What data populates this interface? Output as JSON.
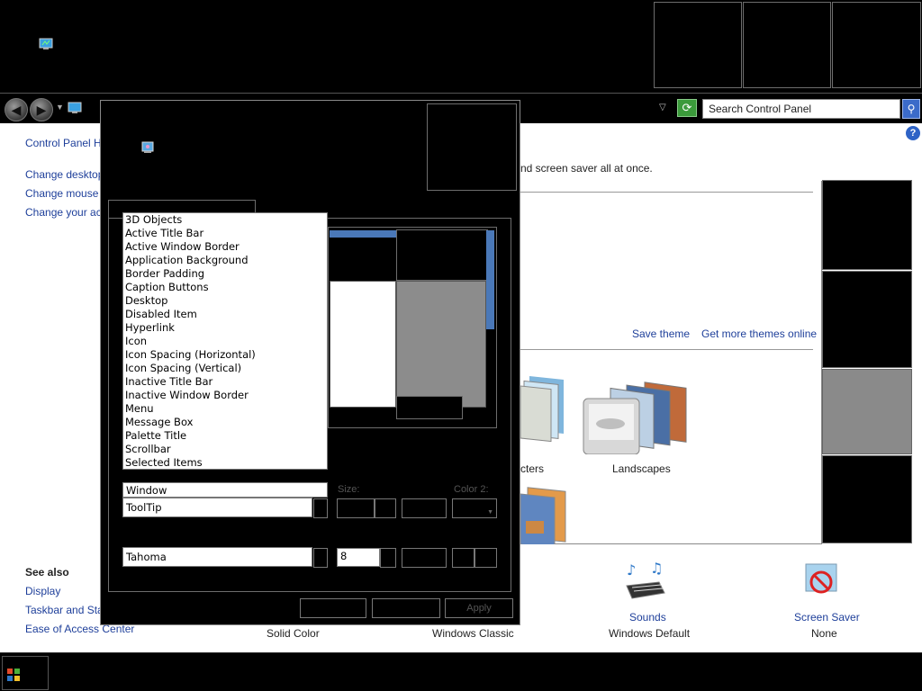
{
  "search": {
    "placeholder": "Search Control Panel"
  },
  "sidebar": {
    "home": "Control Panel Hor",
    "tasks": [
      "Change desktop i",
      "Change mouse po",
      "Change your acc"
    ],
    "see_also_title": "See also",
    "see_also": [
      "Display",
      "Taskbar and Star",
      "Ease of Access Center"
    ]
  },
  "main": {
    "description": "nd screen saver all at once.",
    "save_theme": "Save theme",
    "get_more_themes": "Get more themes online",
    "themes": [
      {
        "name": "cters"
      },
      {
        "name": "Landscapes"
      }
    ],
    "bottom": {
      "background_value": "Solid Color",
      "color_value": "Windows Classic",
      "sounds_label": "Sounds",
      "sounds_value": "Windows Default",
      "screensaver_label": "Screen Saver",
      "screensaver_value": "None"
    }
  },
  "dialog": {
    "items": [
      "3D Objects",
      "Active Title Bar",
      "Active Window Border",
      "Application Background",
      "Border Padding",
      "Caption Buttons",
      "Desktop",
      "Disabled Item",
      "Hyperlink",
      "Icon",
      "Icon Spacing (Horizontal)",
      "Icon Spacing (Vertical)",
      "Inactive Title Bar",
      "Inactive Window Border",
      "Menu",
      "Message Box",
      "Palette Title",
      "Scrollbar",
      "Selected Items"
    ],
    "item_field": "Window",
    "item_select": "ToolTip",
    "size_label": "Size:",
    "color2_label": "Color 2:",
    "font_select": "Tahoma",
    "font_size": "8",
    "apply_label": "Apply"
  },
  "colors": {
    "accent": "#1e3f9a",
    "search_button": "#3b6bc9",
    "preview_blue": "#4a78b8"
  }
}
